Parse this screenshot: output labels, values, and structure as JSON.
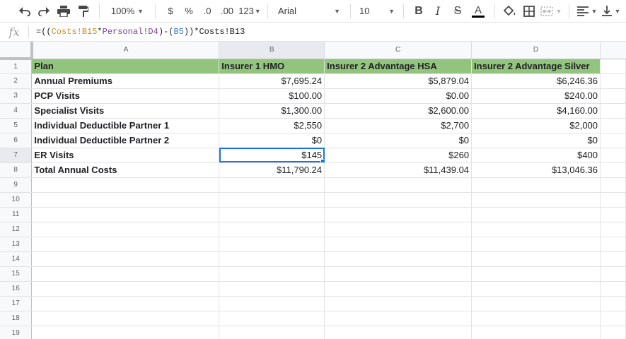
{
  "toolbar": {
    "zoom": "100%",
    "currency": "$",
    "percent": "%",
    "decrease_decimals": ".0",
    "increase_decimals": ".00",
    "more_formats": "123",
    "font": "Arial",
    "font_size": "10",
    "bold": "B",
    "italic": "I",
    "strikethrough": "S",
    "text_color": "A",
    "text_color_value": "#000000"
  },
  "formula_bar": {
    "fx": "fx",
    "parts": [
      "=((",
      "Costs!B15",
      "*",
      "Personal!D4",
      ")-(",
      "B5",
      "))*Costs!B13"
    ]
  },
  "columns": [
    "A",
    "B",
    "C",
    "D"
  ],
  "rows": [
    "1",
    "2",
    "3",
    "4",
    "5",
    "6",
    "7",
    "8",
    "9",
    "10",
    "11",
    "12",
    "13",
    "14",
    "15",
    "16",
    "17",
    "18",
    "19"
  ],
  "header_row": [
    "Plan",
    "Insurer 1 HMO",
    "Insurer 2 Advantage HSA",
    "Insurer 2 Advantage Silver"
  ],
  "data_rows": [
    {
      "label": "Annual Premiums",
      "values": [
        "$7,695.24",
        "$5,879.04",
        "$6,246.36"
      ]
    },
    {
      "label": "PCP Visits",
      "values": [
        "$100.00",
        "$0.00",
        "$240.00"
      ]
    },
    {
      "label": "Specialist Visits",
      "values": [
        "$1,300.00",
        "$2,600.00",
        "$4,160.00"
      ]
    },
    {
      "label": "Individual Deductible Partner 1",
      "values": [
        "$2,550",
        "$2,700",
        "$2,000"
      ]
    },
    {
      "label": "Individual Deductible Partner 2",
      "values": [
        "$0",
        "$0",
        "$0"
      ]
    },
    {
      "label": "ER Visits",
      "values": [
        "$145",
        "$260",
        "$400"
      ]
    },
    {
      "label": "Total Annual Costs",
      "values": [
        "$11,790.24",
        "$11,439.04",
        "$13,046.36"
      ]
    }
  ],
  "header_color": "#93c47d",
  "selection_color": "#1a73e8"
}
